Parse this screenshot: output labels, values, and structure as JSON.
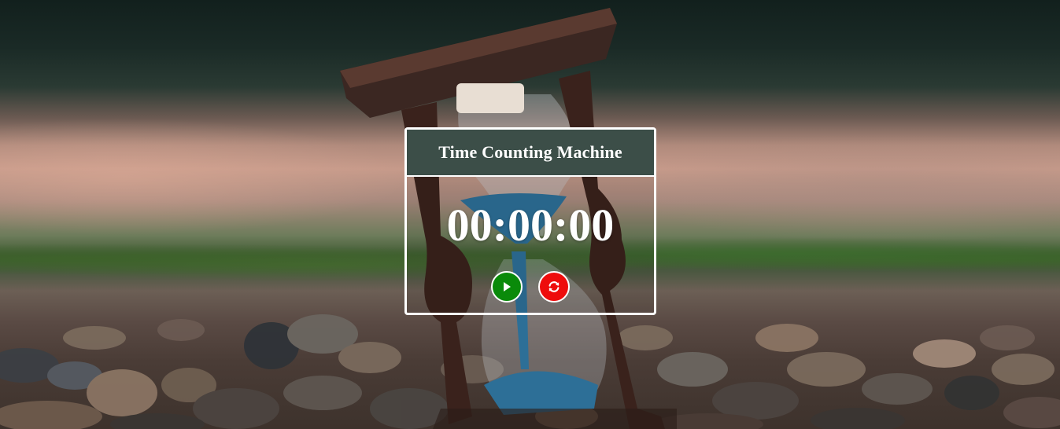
{
  "timer": {
    "title": "Time Counting Machine",
    "display": "00:00:00"
  },
  "controls": {
    "start": {
      "icon": "play-icon",
      "color": "#0a8a0a"
    },
    "reset": {
      "icon": "refresh-icon",
      "color": "#ee0c0c"
    }
  },
  "colors": {
    "header_bg": "#3c4e48",
    "border": "#ffffff",
    "text": "#ffffff"
  }
}
